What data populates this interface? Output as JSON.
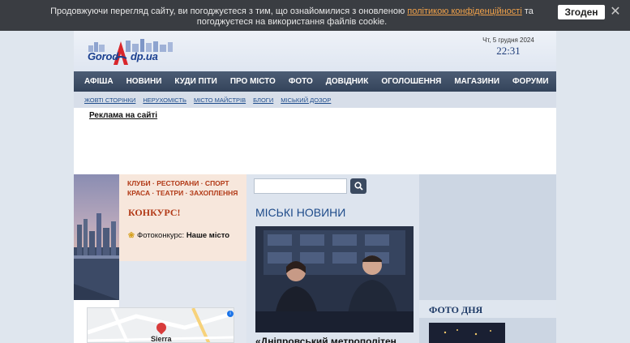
{
  "cookie": {
    "text_before": "Продовжуючи перегляд сайту, ви погоджуєтеся з тим, що ознайомилися з оновленою ",
    "link": "політикою конфіденційності",
    "text_after": " та погоджуєтеся на використання файлів cookie.",
    "accept_label": "Згоден",
    "close_glyph": "✕"
  },
  "header": {
    "logo_text_left": "Gorod",
    "logo_text_right": "dp.ua",
    "date": "Чт, 5 грудня 2024",
    "time": "22:31"
  },
  "main_nav": [
    "АФІША",
    "НОВИНИ",
    "КУДИ ПІТИ",
    "ПРО МІСТО",
    "ФОТО",
    "ДОВІДНИК",
    "ОГОЛОШЕННЯ",
    "МАГАЗИНИ",
    "ФОРУМИ"
  ],
  "sub_nav": [
    "ЖОВТІ СТОРІНКИ",
    "НЕРУХОМІСТЬ",
    "МІСТО МАЙСТРІВ",
    "БЛОГИ",
    "МІСЬКИЙ ДОЗОР"
  ],
  "ad": {
    "link": "Реклама на сайті"
  },
  "promo": {
    "line1": "КЛУБИ · РЕСТОРАНИ · СПОРТ",
    "line2": "КРАСА · ТЕАТРИ · ЗАХОПЛЕННЯ",
    "contest": "КОНКУРС!",
    "photo_contest_label": "Фотоконкурс:",
    "photo_contest_name": "Наше місто"
  },
  "map": {
    "label": "Sierra",
    "info": "i"
  },
  "news": {
    "search_placeholder": "",
    "title": "МІСЬКІ НОВИНИ",
    "caption": "«Дніпровський метрополітен"
  },
  "right": {
    "photo_day": "ФОТО ДНЯ"
  },
  "colors": {
    "nav": "#3e4d64",
    "accent": "#1e4b8a",
    "promo_text": "#b23a17",
    "cookie_link": "#f0a14a"
  },
  "icons": {
    "search": "search-icon",
    "close": "close-icon",
    "star": "star-icon"
  }
}
